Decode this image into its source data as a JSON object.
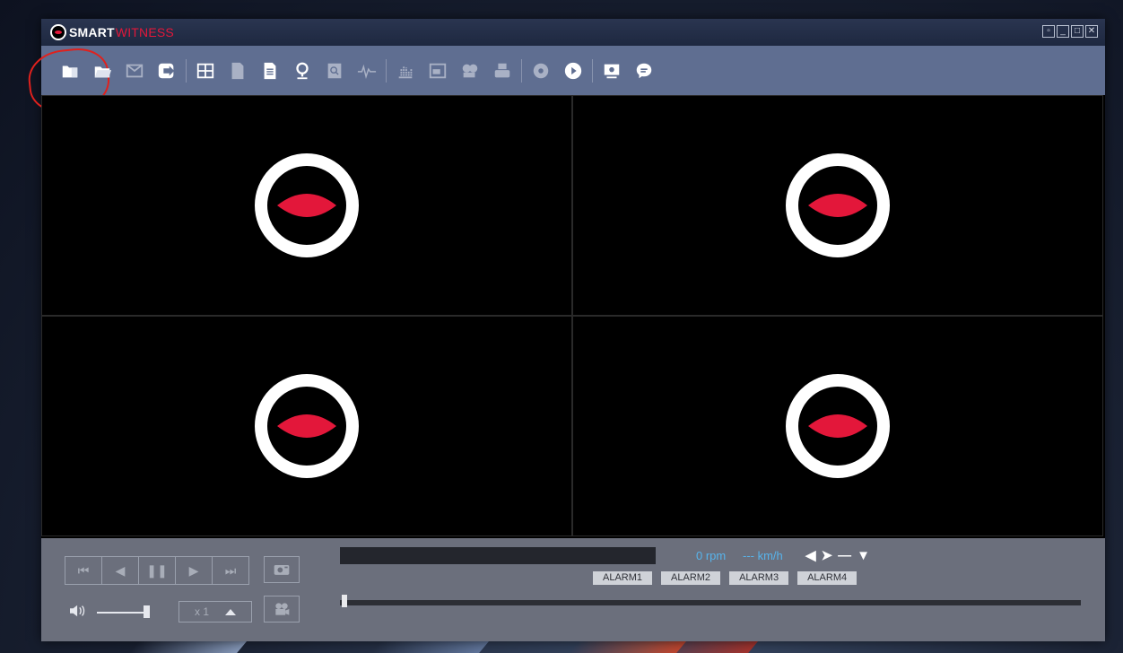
{
  "app": {
    "logo_text_bold": "SMART",
    "logo_text_red": "WITNESS",
    "window_controls": [
      "restore-small-icon",
      "minimize-icon",
      "maximize-icon",
      "close-icon"
    ]
  },
  "toolbar": {
    "items": [
      {
        "name": "open-folder-icon",
        "highlighted": true
      },
      {
        "name": "open-file-icon"
      },
      {
        "name": "email-icon"
      },
      {
        "name": "export-icon"
      },
      {
        "name": "grid-layout-icon"
      },
      {
        "name": "document-icon"
      },
      {
        "name": "report-icon"
      },
      {
        "name": "map-pin-icon"
      },
      {
        "name": "search-document-icon"
      },
      {
        "name": "waveform-icon"
      },
      {
        "name": "chart-icon"
      },
      {
        "name": "video-window-icon"
      },
      {
        "name": "film-reel-icon"
      },
      {
        "name": "printer-icon"
      },
      {
        "name": "disc-icon"
      },
      {
        "name": "play-circle-icon"
      },
      {
        "name": "settings-monitor-icon"
      },
      {
        "name": "chat-icon"
      }
    ]
  },
  "video": {
    "channels": [
      {
        "name": "channel-1"
      },
      {
        "name": "channel-2"
      },
      {
        "name": "channel-3"
      },
      {
        "name": "channel-4"
      }
    ]
  },
  "controls": {
    "speed_label": "x 1",
    "rpm_text": "0 rpm",
    "speed_text": "--- km/h",
    "alarms": [
      "ALARM1",
      "ALARM2",
      "ALARM3",
      "ALARM4"
    ],
    "volume_level": 1.0,
    "timeline_position": 0.0
  },
  "colors": {
    "brand_red": "#e3173a",
    "toolbar_bg": "#5f6e91",
    "info_blue": "#57b4ec"
  }
}
